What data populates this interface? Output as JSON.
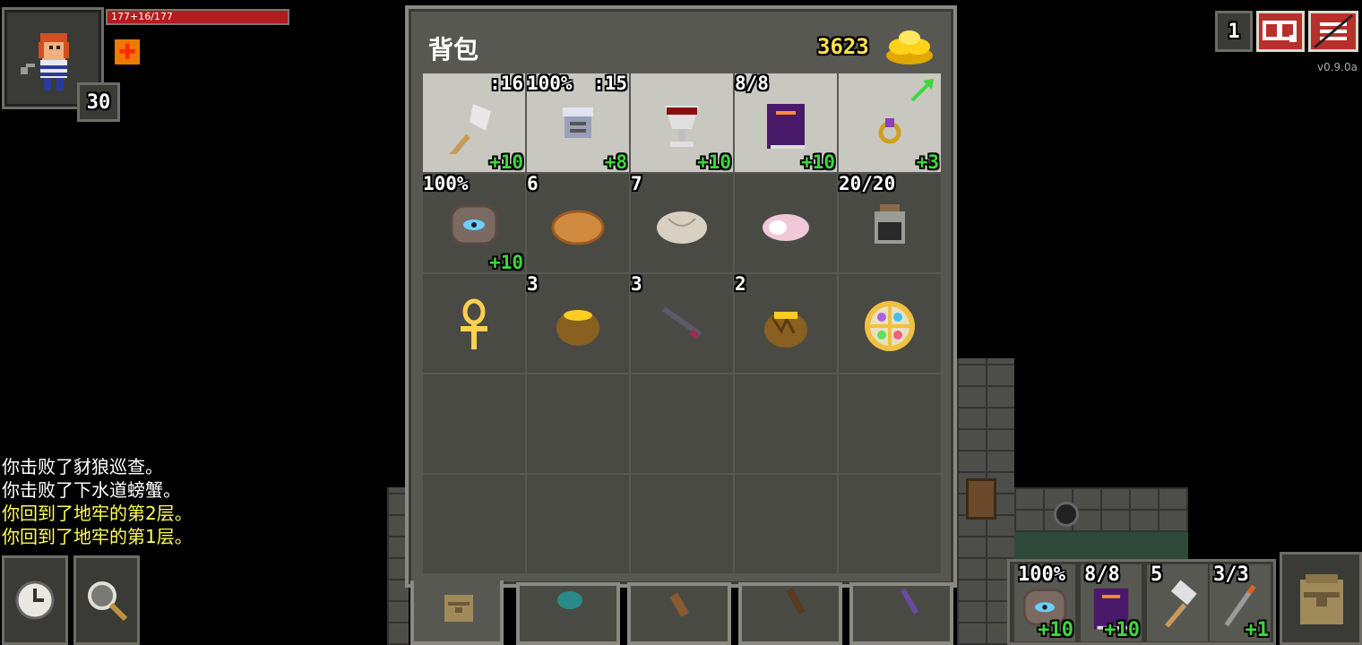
{
  "hero": {
    "hp_text": "177+16/177",
    "level": "30",
    "hp_fraction": 1.0
  },
  "top_right": {
    "depth": "1",
    "version": "v0.9.0a"
  },
  "log": [
    {
      "text": "你击败了豺狼巡查。",
      "color": "#ffffff"
    },
    {
      "text": "你击败了下水道螃蟹。",
      "color": "#ffffff"
    },
    {
      "text": "你回到了地牢的第2层。",
      "color": "#ffff55"
    },
    {
      "text": "你回到了地牢的第1层。",
      "color": "#ffff55"
    }
  ],
  "inventory": {
    "title": "背包",
    "gold": "3623",
    "slots": [
      {
        "tl": "",
        "tr": ":16",
        "br": "+10",
        "icon": "battle-axe-icon",
        "equipped": true
      },
      {
        "tl": "100%",
        "tr": ":15",
        "br": "+8",
        "icon": "plate-armor-icon",
        "equipped": true
      },
      {
        "tl": "",
        "tr": "",
        "br": "+10",
        "icon": "chalice-artifact-icon",
        "equipped": true
      },
      {
        "tl": "8/8",
        "tr": "",
        "br": "+10",
        "icon": "spellbook-icon",
        "equipped": true
      },
      {
        "tl": "",
        "tr": "",
        "br": "+3",
        "icon": "ring-icon",
        "equipped": true
      },
      {
        "tl": "100%",
        "tr": "",
        "br": "+10",
        "icon": "stone-armband-icon",
        "equipped": false
      },
      {
        "tl": "6",
        "tr": "",
        "br": "",
        "icon": "pasty-icon",
        "equipped": false
      },
      {
        "tl": "7",
        "tr": "",
        "br": "",
        "icon": "dumpling-icon",
        "equipped": false
      },
      {
        "tl": "",
        "tr": "",
        "br": "",
        "icon": "mystery-meat-icon",
        "equipped": false
      },
      {
        "tl": "20/20",
        "tr": "",
        "br": "",
        "icon": "dew-vial-icon",
        "equipped": false
      },
      {
        "tl": "",
        "tr": "",
        "br": "",
        "icon": "ankh-icon",
        "equipped": false
      },
      {
        "tl": "3",
        "tr": "",
        "br": "",
        "icon": "honey-pot-icon",
        "equipped": false
      },
      {
        "tl": "3",
        "tr": "",
        "br": "",
        "icon": "dart-icon",
        "equipped": false
      },
      {
        "tl": "2",
        "tr": "",
        "br": "",
        "icon": "honey-pot-broken-icon",
        "equipped": false
      },
      {
        "tl": "",
        "tr": "",
        "br": "",
        "icon": "amulet-icon",
        "equipped": false
      },
      {
        "tl": "",
        "tr": "",
        "br": "",
        "icon": "",
        "equipped": false
      },
      {
        "tl": "",
        "tr": "",
        "br": "",
        "icon": "",
        "equipped": false
      },
      {
        "tl": "",
        "tr": "",
        "br": "",
        "icon": "",
        "equipped": false
      },
      {
        "tl": "",
        "tr": "",
        "br": "",
        "icon": "",
        "equipped": false
      },
      {
        "tl": "",
        "tr": "",
        "br": "",
        "icon": "",
        "equipped": false
      },
      {
        "tl": "",
        "tr": "",
        "br": "",
        "icon": "",
        "equipped": false
      },
      {
        "tl": "",
        "tr": "",
        "br": "",
        "icon": "",
        "equipped": false
      },
      {
        "tl": "",
        "tr": "",
        "br": "",
        "icon": "",
        "equipped": false
      },
      {
        "tl": "",
        "tr": "",
        "br": "",
        "icon": "",
        "equipped": false
      },
      {
        "tl": "",
        "tr": "",
        "br": "",
        "icon": "",
        "equipped": false
      }
    ],
    "tabs": [
      "backpack-tab-icon",
      "seed-pouch-tab-icon",
      "scroll-holder-tab-icon",
      "wand-holster-tab-icon",
      "potion-bandolier-tab-icon"
    ]
  },
  "quickslots": [
    {
      "tl": "100%",
      "br": "+10",
      "icon": "stone-armband-icon"
    },
    {
      "tl": "8/8",
      "br": "+10",
      "icon": "spellbook-icon"
    },
    {
      "tl": "5",
      "br": "",
      "icon": "throwing-hammer-icon"
    },
    {
      "tl": "3/3",
      "br": "+1",
      "icon": "wand-icon"
    }
  ],
  "colors": {
    "gold": "#ffe14a",
    "upgrade_green": "#3dd83d",
    "hp_red": "#b31c1c",
    "panel_bg": "#585853"
  }
}
